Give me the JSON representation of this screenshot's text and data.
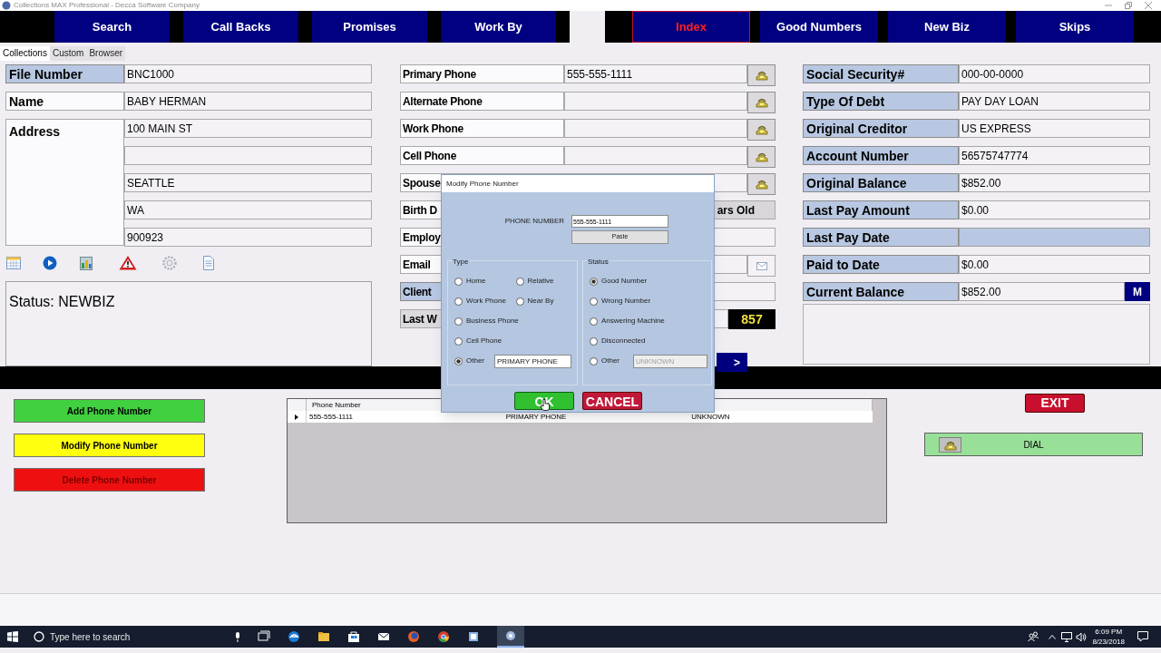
{
  "window": {
    "title": "Collections MAX Professional - Decca Software Company"
  },
  "nav": [
    {
      "label": "Search",
      "selected": false
    },
    {
      "label": "Call Backs",
      "selected": false
    },
    {
      "label": "Promises",
      "selected": false
    },
    {
      "label": "Work By",
      "selected": false
    },
    {
      "label": "Index",
      "selected": true
    },
    {
      "label": "Good Numbers",
      "selected": false
    },
    {
      "label": "New Biz",
      "selected": false
    },
    {
      "label": "Skips",
      "selected": false
    }
  ],
  "tabs": [
    {
      "label": "Collections",
      "selected": true
    },
    {
      "label": "Custom",
      "selected": false
    },
    {
      "label": "Browser",
      "selected": false
    }
  ],
  "left_fields": [
    {
      "label": "File Number",
      "value": "BNC1000",
      "highlighted": true
    },
    {
      "label": "Name",
      "value": "BABY HERMAN",
      "highlighted": false
    }
  ],
  "address": {
    "label": "Address",
    "lines": [
      {
        "value": "100 MAIN ST"
      },
      {
        "kind": "blank"
      },
      {
        "value": "SEATTLE"
      },
      {
        "value": "WA"
      },
      {
        "value": "900923"
      }
    ]
  },
  "status_text": "Status: NEWBIZ",
  "middle_fields": [
    {
      "label": "Primary Phone",
      "value": "555-555-1111",
      "highlighted": false,
      "dimmed": false,
      "field_dimmed": false,
      "kind": "phone"
    },
    {
      "label": "Alternate Phone",
      "highlighted": false,
      "dimmed": false,
      "field_dimmed": false,
      "kind": "phone"
    },
    {
      "label": "Work Phone",
      "highlighted": false,
      "dimmed": false,
      "field_dimmed": false,
      "kind": "phone"
    },
    {
      "label": "Cell Phone",
      "highlighted": false,
      "dimmed": false,
      "field_dimmed": false,
      "kind": "phone"
    },
    {
      "label": "Spouse",
      "highlighted": false,
      "dimmed": false,
      "field_dimmed": false,
      "kind": "phone"
    },
    {
      "label": "Birth D",
      "value": "ars Old",
      "highlighted": false,
      "dimmed": false,
      "field_dimmed": true,
      "kind": "plain"
    },
    {
      "label": "Employ",
      "highlighted": false,
      "dimmed": false,
      "field_dimmed": false,
      "kind": "plain"
    },
    {
      "label": "Email",
      "highlighted": false,
      "dimmed": false,
      "field_dimmed": false,
      "kind": "mail"
    },
    {
      "label": "Client",
      "highlighted": true,
      "dimmed": false,
      "field_dimmed": false,
      "kind": "plain"
    },
    {
      "label": "Last W",
      "highlighted": false,
      "dimmed": true,
      "field_dimmed": false,
      "kind": "count",
      "badge": "857"
    }
  ],
  "next_button": ">",
  "right_fields": [
    {
      "label": "Social Security#",
      "value": "000-00-0000",
      "field_highlighted": false
    },
    {
      "label": "Type Of Debt",
      "value": "PAY DAY LOAN",
      "field_highlighted": false
    },
    {
      "label": "Original Creditor",
      "value": "US EXPRESS",
      "field_highlighted": false
    },
    {
      "label": "Account Number",
      "value": "56575747774",
      "field_highlighted": false
    },
    {
      "label": "Original Balance",
      "value": "$852.00",
      "field_highlighted": false
    },
    {
      "label": "Last Pay Amount",
      "value": "$0.00",
      "field_highlighted": false
    },
    {
      "label": "Last Pay Date",
      "field_highlighted": true
    },
    {
      "label": "Paid to Date",
      "value": "$0.00",
      "field_highlighted": false
    },
    {
      "label": "Current Balance",
      "value": "$852.00",
      "field_highlighted": false,
      "button": "M"
    }
  ],
  "action_buttons": [
    {
      "label": "Add Phone Number",
      "kind": "add"
    },
    {
      "label": "Modify Phone Number",
      "kind": "modify"
    },
    {
      "label": "Delete Phone Number",
      "kind": "delete"
    }
  ],
  "phone_grid": {
    "columns": [
      {
        "label": "Phone Number"
      },
      {
        "kind": "covered"
      },
      {
        "kind": "covered"
      }
    ],
    "rows": [
      {
        "cells": [
          "555-555-1111",
          "PRIMARY PHONE",
          "UNKNOWN"
        ],
        "selected": true
      }
    ]
  },
  "exit_button": "EXIT",
  "dial_button": "DIAL",
  "dialog": {
    "title": "Modify Phone Number",
    "phone_label": "PHONE NUMBER",
    "phone_value": "555-555-1111",
    "paste_button": "Paste",
    "type_group": {
      "title": "Type",
      "other_value": "PRIMARY PHONE",
      "other_disabled": false,
      "options": [
        {
          "label": "Home",
          "selected": false
        },
        {
          "label": "Relative",
          "selected": false
        },
        {
          "label": "Work Phone",
          "selected": false
        },
        {
          "label": "Near By",
          "selected": false
        },
        {
          "label": "Business Phone",
          "selected": false
        },
        {
          "label": "Cell Phone",
          "selected": false
        },
        {
          "label": "Other",
          "selected": true,
          "kind": "other"
        }
      ]
    },
    "status_group": {
      "title": "Status",
      "other_value": "UNKNOWN",
      "other_disabled": true,
      "options": [
        {
          "label": "Good Number",
          "selected": true
        },
        {
          "label": "Wrong Number",
          "selected": false
        },
        {
          "label": "Answering Machine",
          "selected": false
        },
        {
          "label": "Disconnected",
          "selected": false
        },
        {
          "label": "Other",
          "selected": false,
          "kind": "other"
        }
      ]
    },
    "ok_button": "OK",
    "cancel_button": "CANCEL"
  },
  "taskbar": {
    "search_placeholder": "Type here to search",
    "time": "6:09 PM",
    "date": "8/23/2018"
  }
}
